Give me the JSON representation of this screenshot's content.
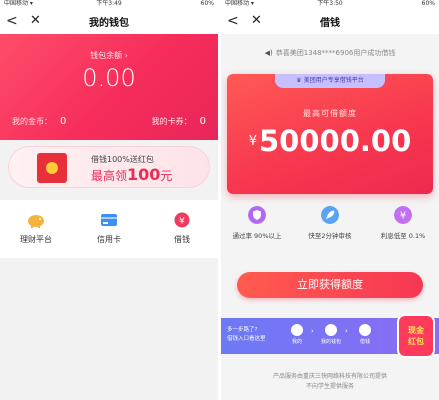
{
  "left": {
    "status": {
      "carrier": "中国移动 ▾",
      "time": "下午3:49",
      "battery": "60%"
    },
    "nav": {
      "back": "<",
      "close": "✕",
      "title": "我的钱包"
    },
    "wallet": {
      "balance_label": "钱包余额 ›",
      "balance": "0.00",
      "coins_label": "我的金币：",
      "coins": "0",
      "cards_label": "我的卡券：",
      "cards": "0"
    },
    "promo": {
      "line1": "借钱100%送红包",
      "line2_prefix": "最高领",
      "line2_amount": "100",
      "line2_suffix": "元"
    },
    "grid": [
      {
        "label": "理财平台",
        "icon": "piggy-bank-icon",
        "color": "#f5b23d"
      },
      {
        "label": "信用卡",
        "icon": "credit-card-icon",
        "color": "#3d8ff5"
      },
      {
        "label": "借钱",
        "icon": "yen-icon",
        "color": "#ef3b5d"
      }
    ]
  },
  "right": {
    "status": {
      "carrier": "中国移动 ▾",
      "time": "下午3:50",
      "battery": "60%"
    },
    "nav": {
      "back": "<",
      "close": "✕",
      "title": "借钱"
    },
    "notice": "恭喜美团1348****6906用户成功借钱",
    "card": {
      "tag": "美团用户专享借钱平台",
      "max_label": "最高可借额度",
      "currency": "¥",
      "amount": "50000.00"
    },
    "features": [
      {
        "text": "通过率 90%以上",
        "color": "#b268f5",
        "icon": "shield-icon"
      },
      {
        "text": "快至2分钟审核",
        "color": "#5aa2f5",
        "icon": "rocket-icon"
      },
      {
        "text": "利息低至 0.1%",
        "color": "#c070f0",
        "icon": "yen-coin-icon"
      }
    ],
    "cta": "立即获得额度",
    "guide": {
      "line1": "多一步路了?",
      "line2": "借钱入口看这里",
      "steps": [
        "我的",
        "我的钱包",
        "借钱"
      ]
    },
    "redpack": {
      "line1": "现金",
      "line2": "红包"
    },
    "footer": {
      "line1": "产品服务由重庆三快网络科技有限公司提供",
      "line2": "不向学生提供服务"
    }
  }
}
